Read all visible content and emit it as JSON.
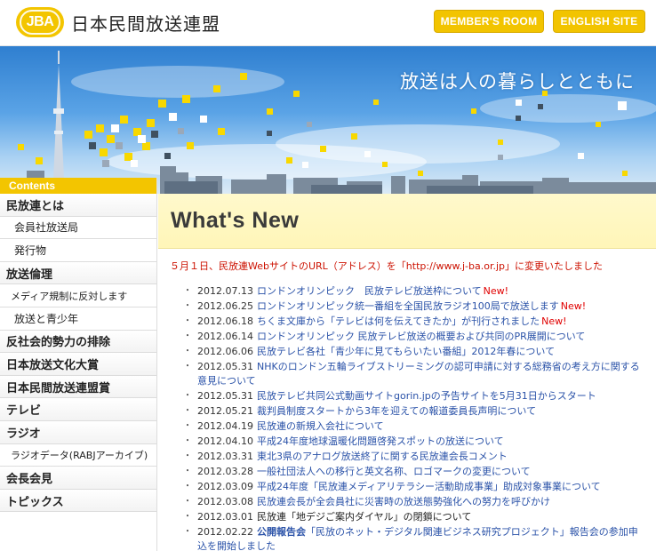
{
  "header": {
    "logo_badge": "JBA",
    "logo_text": "日本民間放送連盟",
    "member_button": "MEMBER'S ROOM",
    "english_button": "ENGLISH SITE",
    "brand_color": "#f3c500"
  },
  "banner": {
    "tagline": "放送は人の暮らしとともに"
  },
  "sidebar": {
    "heading": "Contents",
    "items": [
      {
        "label": "民放連とは",
        "level": "major"
      },
      {
        "label": "会員社放送局",
        "level": "sub"
      },
      {
        "label": "発行物",
        "level": "sub"
      },
      {
        "label": "放送倫理",
        "level": "major"
      },
      {
        "label": "メディア規制に反対します",
        "level": "sub-small"
      },
      {
        "label": "放送と青少年",
        "level": "sub"
      },
      {
        "label": "反社会的勢力の排除",
        "level": "major"
      },
      {
        "label": "日本放送文化大賞",
        "level": "major"
      },
      {
        "label": "日本民間放送連盟賞",
        "level": "major"
      },
      {
        "label": "テレビ",
        "level": "major"
      },
      {
        "label": "ラジオ",
        "level": "major"
      },
      {
        "label": "ラジオデータ(RABJアーカイブ)",
        "level": "sub-small"
      },
      {
        "label": "会長会見",
        "level": "major"
      },
      {
        "label": "トピックス",
        "level": "major"
      }
    ]
  },
  "main": {
    "title": "What's New",
    "notice": "５月１日、民放連WebサイトのURL（アドレス）を「http://www.j-ba.or.jp」に変更いたしました",
    "news": [
      {
        "date": "2012.07.13",
        "title": "ロンドンオリンピック　民放テレビ放送枠について",
        "new": "New!",
        "style": "link"
      },
      {
        "date": "2012.06.25",
        "title": "ロンドンオリンピック統一番組を全国民放ラジオ100局で放送します",
        "new": "New!",
        "style": "link"
      },
      {
        "date": "2012.06.18",
        "title": "ちくま文庫から「テレビは何を伝えてきたか」が刊行されました",
        "new": "New!",
        "style": "link"
      },
      {
        "date": "2012.06.14",
        "title": "ロンドンオリンピック 民放テレビ放送の概要および共同のPR展開について",
        "new": "",
        "style": "link"
      },
      {
        "date": "2012.06.06",
        "title": "民放テレビ各社「青少年に見てもらいたい番組」2012年春について",
        "new": "",
        "style": "link"
      },
      {
        "date": "2012.05.31",
        "title": "NHKのロンドン五輪ライブストリーミングの認可申請に対する総務省の考え方に関する意見について",
        "new": "",
        "style": "link"
      },
      {
        "date": "2012.05.31",
        "title": "民放テレビ共同公式動画サイトgorin.jpの予告サイトを5月31日からスタート",
        "new": "",
        "style": "link"
      },
      {
        "date": "2012.05.21",
        "title": "裁判員制度スタートから3年を迎えての報道委員長声明について",
        "new": "",
        "style": "link"
      },
      {
        "date": "2012.04.19",
        "title": "民放連の新規入会社について",
        "new": "",
        "style": "link"
      },
      {
        "date": "2012.04.10",
        "title": "平成24年度地球温暖化問題啓発スポットの放送について",
        "new": "",
        "style": "link"
      },
      {
        "date": "2012.03.31",
        "title": "東北3県のアナログ放送終了に関する民放連会長コメント",
        "new": "",
        "style": "link"
      },
      {
        "date": "2012.03.28",
        "title": "一般社団法人への移行と英文名称、ロゴマークの変更について",
        "new": "",
        "style": "link"
      },
      {
        "date": "2012.03.09",
        "title": "平成24年度「民放連メディアリテラシー活動助成事業」助成対象事業について",
        "new": "",
        "style": "link"
      },
      {
        "date": "2012.03.08",
        "title": "民放連会長が全会員社に災害時の放送態勢強化への努力を呼びかけ",
        "new": "",
        "style": "link"
      },
      {
        "date": "2012.03.01",
        "title": "民放連「地デジご案内ダイヤル」の閉鎖について",
        "new": "",
        "style": "dark"
      },
      {
        "date": "2012.02.22",
        "title": "公開報告会",
        "after": "「民放のネット・デジタル関連ビジネス研究プロジェクト」報告会の参加申込を開始しました",
        "new": "",
        "style": "bold"
      }
    ]
  }
}
